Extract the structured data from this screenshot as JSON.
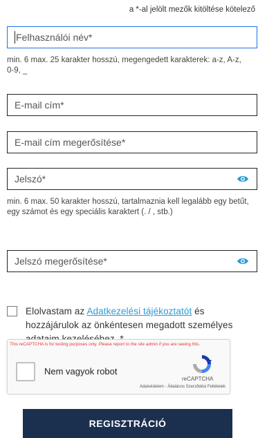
{
  "form": {
    "required_note": "a *-al jelölt mezők kitöltése kötelező",
    "username": {
      "placeholder": "Felhasználói név*"
    },
    "username_hint": "min. 6 max. 25 karakter hosszú, megengedett karakterek: a-z, A-z, 0-9, _",
    "email": {
      "placeholder": "E-mail cím*"
    },
    "email_confirm": {
      "placeholder": "E-mail cím megerősítése*"
    },
    "password": {
      "placeholder": "Jelszó*"
    },
    "password_hint": "min. 6 max. 50 karakter hosszú, tartalmaznia kell legalább egy betűt, egy számot és egy speciális karaktert (. / , stb.)",
    "password_confirm": {
      "placeholder": "Jelszó megerősítése*"
    },
    "consent": {
      "prefix": "Elolvastam az ",
      "link": "Adatkezelési tájékoztatót",
      "suffix": " és hozzájárulok az önkéntesen megadott személyes adataim kezeléséhez. *"
    },
    "captcha": {
      "warning": "This reCAPTCHA is for testing purposes only. Please report to the site admin if you are seeing this.",
      "label": "Nem vagyok robot",
      "brand": "reCAPTCHA",
      "links": "Adatvédelem - Általános Szerződési Feltételek"
    },
    "submit_label": "REGISZTRÁCIÓ"
  },
  "colors": {
    "accent": "#2b9bd6",
    "active_border": "#1a73e8",
    "button": "#1b2f4e",
    "captcha_warning": "#e53935"
  },
  "icons": {
    "password_toggle": "eye-icon",
    "captcha_logo": "recaptcha-logo"
  }
}
